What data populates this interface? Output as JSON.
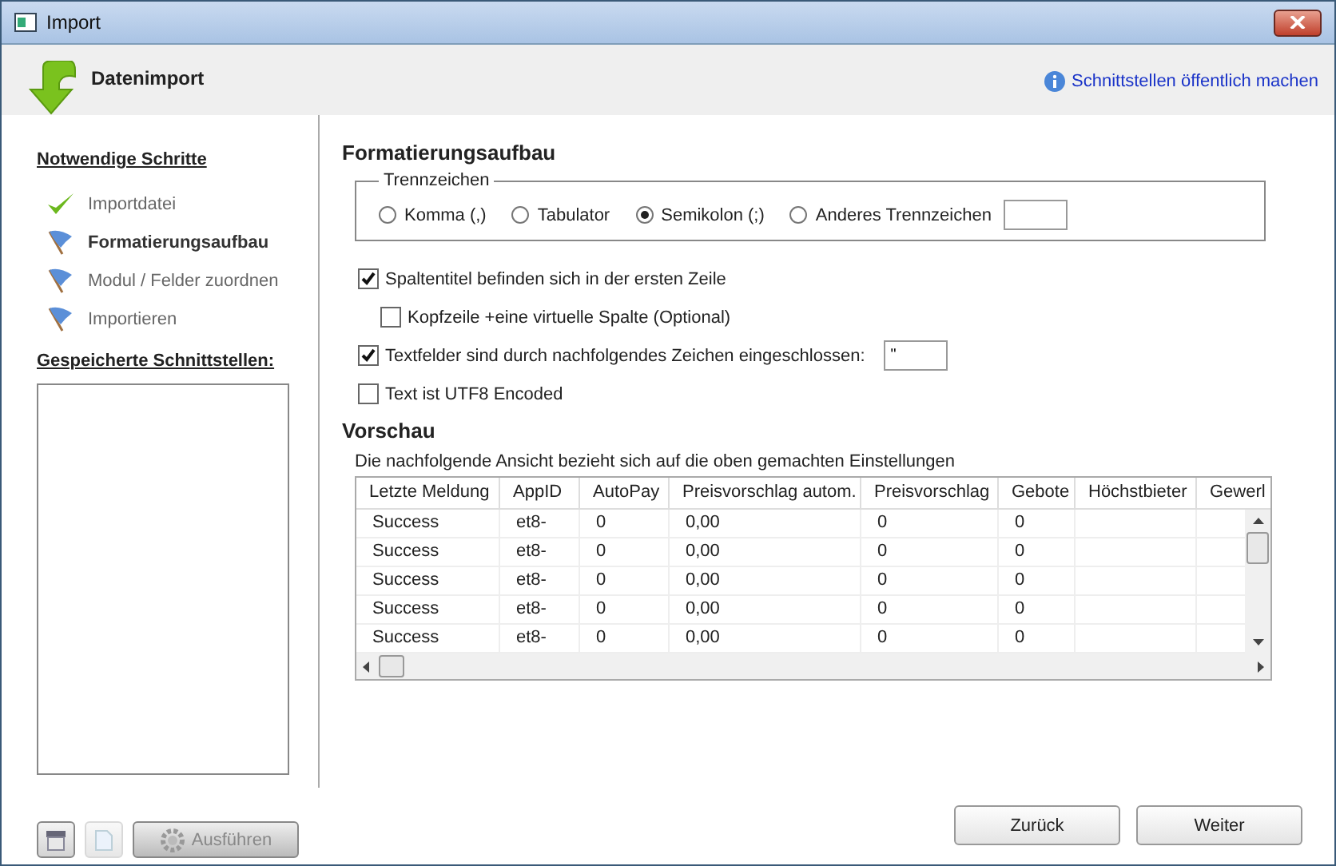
{
  "window": {
    "title": "Import"
  },
  "header": {
    "title": "Datenimport",
    "link": "Schnittstellen öffentlich machen"
  },
  "steps": {
    "title": "Notwendige Schritte",
    "items": [
      {
        "label": "Importdatei",
        "kind": "done"
      },
      {
        "label": "Formatierungsaufbau",
        "kind": "current"
      },
      {
        "label": "Modul / Felder zuordnen",
        "kind": "pending"
      },
      {
        "label": "Importieren",
        "kind": "pending"
      }
    ]
  },
  "saved": {
    "title": "Gespeicherte Schnittstellen:",
    "buttons": [
      {
        "kind": "delete",
        "disabled": false
      },
      {
        "kind": "new",
        "disabled": true
      },
      {
        "kind": "run",
        "label": "Ausführen",
        "disabled": true
      }
    ]
  },
  "format": {
    "title": "Formatierungsaufbau",
    "separator_group": "Trennzeichen",
    "separators": [
      {
        "label": "Komma (,)",
        "selected": false
      },
      {
        "label": "Tabulator",
        "selected": false
      },
      {
        "label": "Semikolon (;)",
        "selected": true
      },
      {
        "label": "Anderes Trennzeichen",
        "selected": false
      }
    ],
    "options": [
      {
        "label": "Spaltentitel befinden sich in der ersten Zeile",
        "checked": true,
        "indented": false
      },
      {
        "label": "Kopfzeile +eine virtuelle Spalte (Optional)",
        "checked": false,
        "indented": true
      },
      {
        "label": "Textfelder sind durch nachfolgendes Zeichen eingeschlossen:",
        "checked": true,
        "indented": false,
        "value": "\""
      },
      {
        "label": "Text ist UTF8 Encoded",
        "checked": false,
        "indented": false
      }
    ]
  },
  "preview": {
    "title": "Vorschau",
    "note": "Die nachfolgende Ansicht bezieht sich auf die oben gemachten Einstellungen",
    "columns": [
      "Letzte Meldung",
      "AppID",
      "AutoPay",
      "Preisvorschlag autom.",
      "Preisvorschlag",
      "Gebote",
      "Höchstbieter",
      "Gewerl"
    ],
    "rows": [
      [
        "Success",
        "et8-",
        "0",
        "0,00",
        "0",
        "0"
      ],
      [
        "Success",
        "et8-",
        "0",
        "0,00",
        "0",
        "0"
      ],
      [
        "Success",
        "et8-",
        "0",
        "0,00",
        "0",
        "0"
      ],
      [
        "Success",
        "et8-",
        "0",
        "0,00",
        "0",
        "0"
      ],
      [
        "Success",
        "et8-",
        "0",
        "0,00",
        "0",
        "0"
      ]
    ]
  },
  "buttons": [
    "Zurück",
    "Weiter"
  ]
}
